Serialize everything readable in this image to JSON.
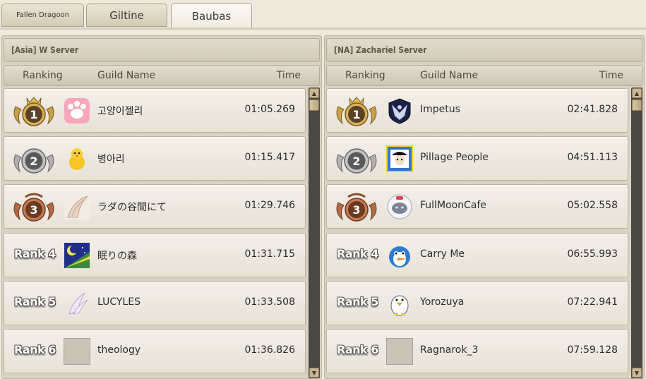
{
  "tabs": [
    {
      "label": "Fallen Dragoon",
      "active": false
    },
    {
      "label": "Giltine",
      "active": false
    },
    {
      "label": "Baubas",
      "active": true
    }
  ],
  "columns": {
    "ranking": "Ranking",
    "guild": "Guild Name",
    "time": "Time"
  },
  "panels": [
    {
      "server": "[Asia] W Server",
      "rows": [
        {
          "rank": "1",
          "guild": "고양이젤리",
          "time": "01:05.269",
          "emblem": "paw-emblem-icon"
        },
        {
          "rank": "2",
          "guild": "병아리",
          "time": "01:15.417",
          "emblem": "chick-emblem-icon"
        },
        {
          "rank": "3",
          "guild": "ラダの谷間にて",
          "time": "01:29.746",
          "emblem": "wing-emblem-icon"
        },
        {
          "rank": "Rank 4",
          "guild": "眠りの森",
          "time": "01:31.715",
          "emblem": "moon-emblem-icon"
        },
        {
          "rank": "Rank 5",
          "guild": "LUCYLES",
          "time": "01:33.508",
          "emblem": "feather-emblem-icon"
        },
        {
          "rank": "Rank 6",
          "guild": "theology",
          "time": "01:36.826",
          "emblem": "no-emblem-icon"
        }
      ]
    },
    {
      "server": "[NA] Zachariel Server",
      "rows": [
        {
          "rank": "1",
          "guild": "Impetus",
          "time": "02:41.828",
          "emblem": "phoenix-emblem-icon"
        },
        {
          "rank": "2",
          "guild": "Pillage People",
          "time": "04:51.113",
          "emblem": "pirate-emblem-icon"
        },
        {
          "rank": "3",
          "guild": "FullMoonCafe",
          "time": "05:02.558",
          "emblem": "yeti-emblem-icon"
        },
        {
          "rank": "Rank 4",
          "guild": "Carry Me",
          "time": "06:55.993",
          "emblem": "penguin-blue-emblem-icon"
        },
        {
          "rank": "Rank 5",
          "guild": "Yorozuya",
          "time": "07:22.941",
          "emblem": "penguin-white-emblem-icon"
        },
        {
          "rank": "Rank 6",
          "guild": "Ragnarok_3",
          "time": "07:59.128",
          "emblem": "no-emblem-icon"
        }
      ]
    }
  ],
  "colors": {
    "gold": "#c9a14a",
    "silver": "#a9a9a9",
    "bronze": "#b56b45"
  }
}
